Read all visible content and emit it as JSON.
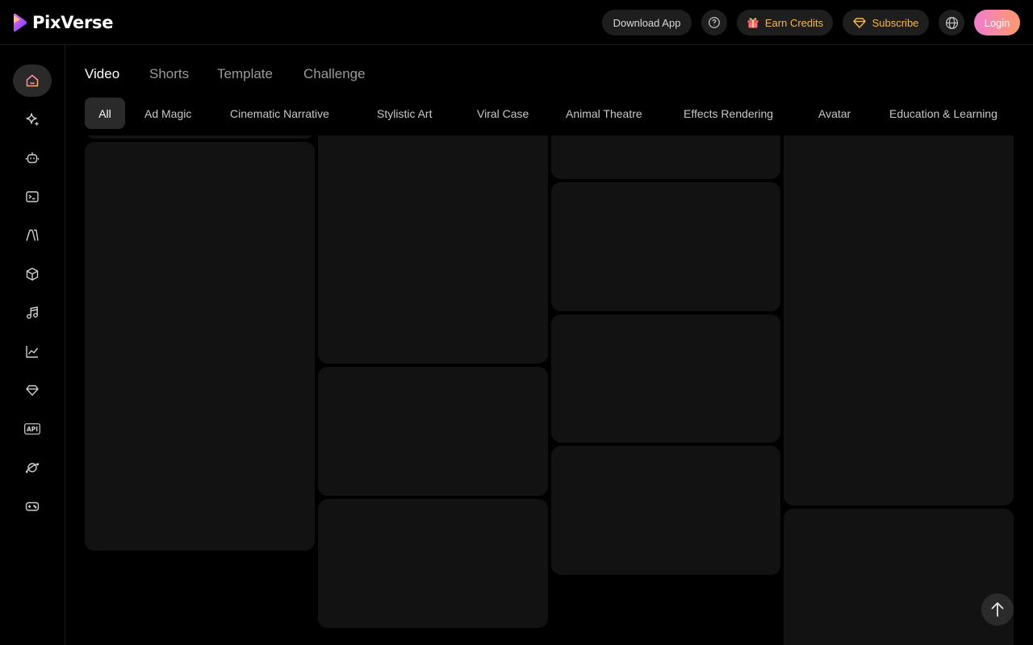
{
  "brand": {
    "name": "PixVerse"
  },
  "header": {
    "download_label": "Download App",
    "earn_label": "Earn Credits",
    "subscribe_label": "Subscribe",
    "login_label": "Login"
  },
  "sidebar": {
    "items": [
      {
        "icon": "home-icon",
        "active": true
      },
      {
        "icon": "sparkle-icon"
      },
      {
        "icon": "robot-icon"
      },
      {
        "icon": "terminal-icon"
      },
      {
        "icon": "brush-icon"
      },
      {
        "icon": "cube-icon"
      },
      {
        "icon": "music-icon"
      },
      {
        "icon": "chart-icon"
      },
      {
        "icon": "tag-icon"
      },
      {
        "icon": "api-icon"
      },
      {
        "icon": "planet-icon"
      },
      {
        "icon": "gamepad-icon"
      }
    ],
    "api_text": "API"
  },
  "main_tabs": [
    "Video",
    "Shorts",
    "Template",
    "Challenge"
  ],
  "categories": [
    "All",
    "Ad Magic",
    "Cinematic Narrative",
    "Stylistic Art",
    "Viral Case",
    "Animal Theatre",
    "Effects Rendering",
    "Avatar",
    "Education & Learning"
  ],
  "colors": {
    "accent_gold": "#f3b94a",
    "login_gradient_start": "#f27bd0",
    "login_gradient_end": "#ff9a6a",
    "card_bg": "#121212"
  }
}
